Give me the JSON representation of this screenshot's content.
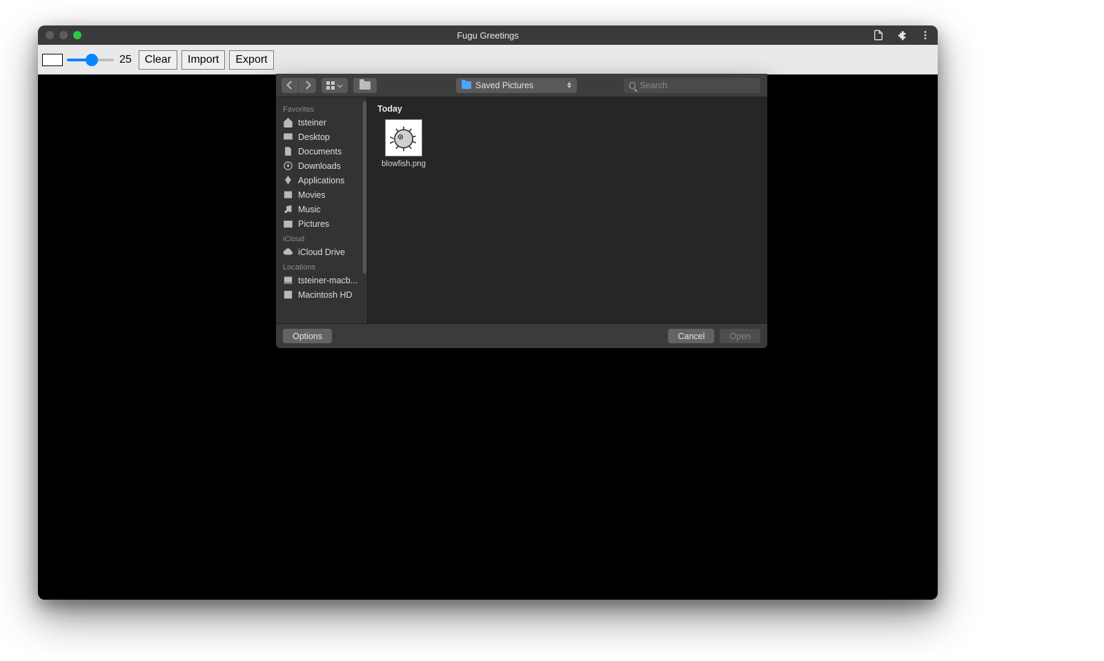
{
  "window": {
    "title": "Fugu Greetings"
  },
  "toolbar": {
    "slider_value": "25",
    "clear": "Clear",
    "import": "Import",
    "export": "Export"
  },
  "dialog": {
    "path": "Saved Pictures",
    "search_placeholder": "Search",
    "sidebar": {
      "favorites_header": "Favorites",
      "favorites": [
        {
          "icon": "home",
          "label": "tsteiner"
        },
        {
          "icon": "desktop",
          "label": "Desktop"
        },
        {
          "icon": "document",
          "label": "Documents"
        },
        {
          "icon": "download",
          "label": "Downloads"
        },
        {
          "icon": "apps",
          "label": "Applications"
        },
        {
          "icon": "movies",
          "label": "Movies"
        },
        {
          "icon": "music",
          "label": "Music"
        },
        {
          "icon": "pictures",
          "label": "Pictures"
        }
      ],
      "icloud_header": "iCloud",
      "icloud": [
        {
          "icon": "cloud",
          "label": "iCloud Drive"
        }
      ],
      "locations_header": "Locations",
      "locations": [
        {
          "icon": "laptop",
          "label": "tsteiner-macb..."
        },
        {
          "icon": "disk",
          "label": "Macintosh HD"
        }
      ]
    },
    "group_header": "Today",
    "files": [
      {
        "name": "blowfish.png"
      }
    ],
    "options": "Options",
    "cancel": "Cancel",
    "open": "Open"
  }
}
